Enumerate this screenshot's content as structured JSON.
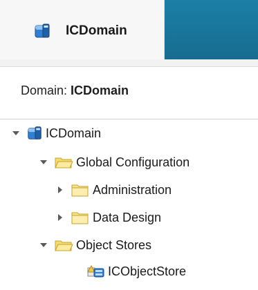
{
  "tab": {
    "label": "ICDomain",
    "icon": "domain-icon"
  },
  "domain_line": {
    "prefix": "Domain: ",
    "value": "ICDomain"
  },
  "tree": {
    "root": {
      "label": "ICDomain",
      "expanded": true,
      "icon": "domain-icon"
    },
    "global_configuration": {
      "label": "Global Configuration",
      "expanded": true,
      "icon": "folder-open-icon"
    },
    "administration": {
      "label": "Administration",
      "expanded": false,
      "icon": "folder-icon"
    },
    "data_design": {
      "label": "Data Design",
      "expanded": false,
      "icon": "folder-icon"
    },
    "object_stores": {
      "label": "Object Stores",
      "expanded": true,
      "icon": "folder-open-icon"
    },
    "icobjectstore": {
      "label": "ICObjectStore",
      "icon": "object-store-icon"
    }
  },
  "colors": {
    "tabbar": "#176c90",
    "folder": "#f6e27a",
    "folder_stroke": "#c9a227",
    "domain_blue": "#1f6fc4"
  }
}
